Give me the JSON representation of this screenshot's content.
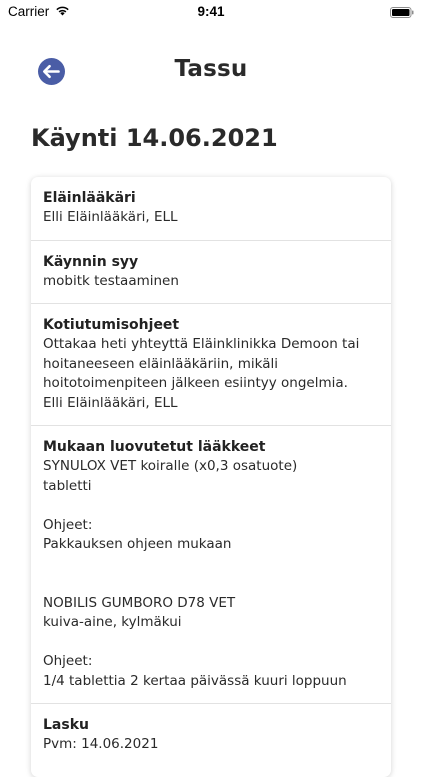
{
  "status_bar": {
    "carrier": "Carrier",
    "time": "9:41",
    "wifi_icon": "wifi-icon",
    "battery_icon": "battery-icon"
  },
  "header": {
    "title": "Tassu",
    "back_icon": "arrow-left-circle-icon"
  },
  "visit": {
    "title": "Käynti 14.06.2021"
  },
  "sections": {
    "vet": {
      "title": "Eläinlääkäri",
      "value": "Elli Eläinlääkäri, ELL"
    },
    "reason": {
      "title": "Käynnin syy",
      "value": "mobitk testaaminen"
    },
    "instructions": {
      "title": "Kotiutumisohjeet",
      "lines": [
        "Ottakaa heti yhteyttä Eläinklinikka Demoon tai",
        "hoitaneeseen eläinlääkäriin, mikäli",
        "hoitotoimenpiteen jälkeen esiintyy ongelmia.",
        "Elli Eläinlääkäri, ELL"
      ]
    },
    "medicines": {
      "title": "Mukaan luovutetut lääkkeet",
      "items": [
        {
          "name": "SYNULOX VET koiralle (x0,3 osatuote)",
          "form": "tabletti",
          "instructions_label": "Ohjeet:",
          "instructions": "Pakkauksen ohjeen mukaan"
        },
        {
          "name": "NOBILIS GUMBORO D78 VET",
          "form": "kuiva-aine, kylmäkui",
          "instructions_label": "Ohjeet:",
          "instructions": "1/4 tablettia 2 kertaa päivässä kuuri loppuun"
        }
      ]
    },
    "invoice": {
      "title": "Lasku",
      "date_line": "Pvm: 14.06.2021"
    }
  },
  "colors": {
    "accent": "#4a5da6",
    "text": "#2a2a2a",
    "divider": "#e2e2e2"
  }
}
